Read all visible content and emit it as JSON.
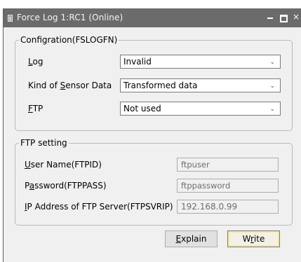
{
  "window": {
    "title": "Force Log 1:RC1 (Online)",
    "close_glyph": "×"
  },
  "configuration": {
    "legend": "Configration(FSLOGFN)",
    "log": {
      "label_pre": "",
      "label_key": "L",
      "label_post": "og",
      "value": "Invalid"
    },
    "sensor": {
      "label_pre": "Kind of ",
      "label_key": "S",
      "label_post": "ensor Data",
      "value": "Transformed data"
    },
    "ftp": {
      "label_pre": "",
      "label_key": "F",
      "label_post": "TP",
      "value": "Not used"
    },
    "chevron": "⌄"
  },
  "ftp_setting": {
    "legend": "FTP setting",
    "user": {
      "label_pre": "",
      "label_key": "U",
      "label_post": "ser Name(FTPID)",
      "value": "ftpuser"
    },
    "password": {
      "label_pre": "P",
      "label_key": "a",
      "label_post": "ssword(FTPPASS)",
      "value": "ftppassword"
    },
    "ip": {
      "label_pre": "",
      "label_key": "I",
      "label_post": "P Address of FTP Server(FTPSVRIP)",
      "value": "192.168.0.99"
    }
  },
  "buttons": {
    "explain": {
      "pre": "",
      "key": "E",
      "post": "xplain"
    },
    "write": {
      "pre": "W",
      "key": "r",
      "post": "ite"
    }
  }
}
